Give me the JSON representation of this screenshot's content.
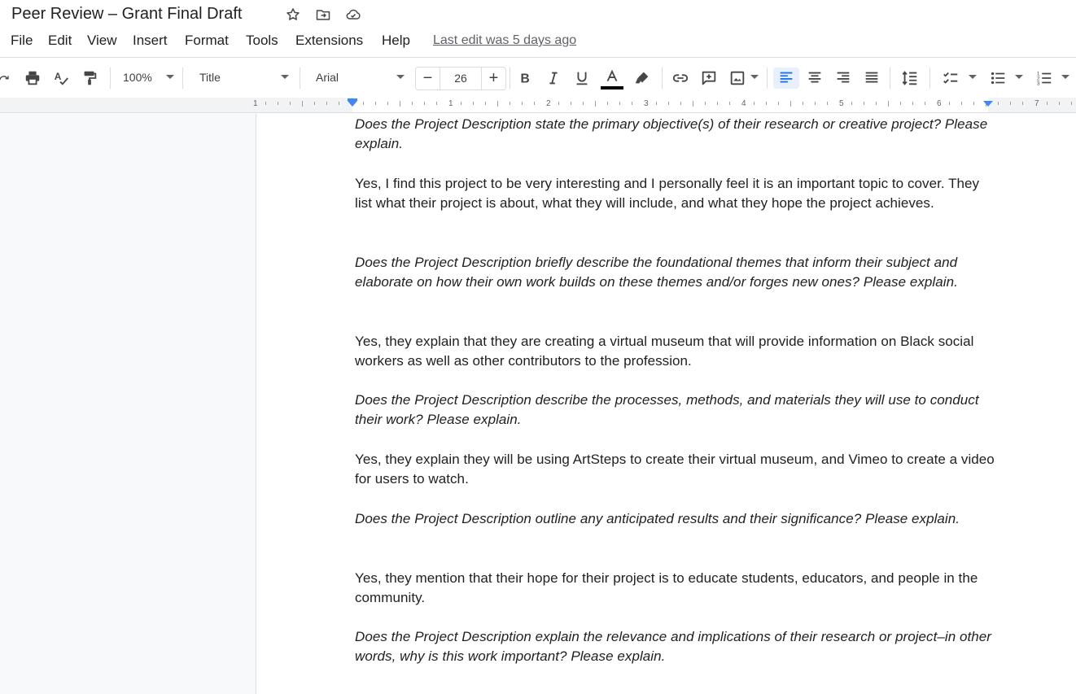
{
  "app": {
    "doc_title": "Peer Review – Grant Final Draft",
    "title_icons": [
      "star-icon",
      "move-to-folder-icon",
      "cloud-saved-icon"
    ]
  },
  "menu": {
    "items": [
      "File",
      "Edit",
      "View",
      "Insert",
      "Format",
      "Tools",
      "Extensions",
      "Help"
    ],
    "last_edit": "Last edit was 5 days ago"
  },
  "toolbar": {
    "zoom": "100%",
    "style": "Title",
    "font": "Arial",
    "font_size": "26",
    "minus_label": "−",
    "plus_label": "+",
    "text_color": "#000000",
    "icons": [
      "redo-icon",
      "print-icon",
      "spellcheck-icon",
      "paint-format-icon",
      "bold-icon",
      "italic-icon",
      "underline-icon",
      "text-color-icon",
      "highlight-icon",
      "link-icon",
      "add-comment-icon",
      "insert-image-icon",
      "align-left-icon",
      "align-center-icon",
      "align-right-icon",
      "justify-icon",
      "line-spacing-icon",
      "checklist-icon",
      "bulleted-list-icon",
      "numbered-list-icon"
    ]
  },
  "ruler": {
    "numbers": [
      "1",
      "1",
      "2",
      "3",
      "4",
      "5",
      "6",
      "7"
    ]
  },
  "document": {
    "paragraphs": [
      {
        "type": "question",
        "text": "Does the Project Description state the primary objective(s) of their research or creative project? Please explain."
      },
      {
        "type": "answer",
        "text": "Yes, I find this project to be very interesting and I personally feel it is an important topic to cover. They list what their project is about, what they will include, and what they hope the project achieves."
      },
      {
        "type": "question",
        "text": "Does the Project Description briefly describe the foundational themes that inform their subject and elaborate on how their own work builds on these themes and/or forges new ones? Please explain."
      },
      {
        "type": "answer",
        "text": "Yes, they explain that they are creating a virtual museum that will provide information on Black social workers as well as other contributors to the profession."
      },
      {
        "type": "question",
        "text": "Does the Project Description describe the processes, methods, and materials they will use to conduct their work? Please explain."
      },
      {
        "type": "answer",
        "text": "Yes, they explain they will be using ArtSteps to create their virtual museum, and Vimeo to create a video for users to watch."
      },
      {
        "type": "question",
        "text": "Does the Project Description outline any anticipated results and their significance? Please explain."
      },
      {
        "type": "answer",
        "text": "Yes, they mention that their hope for their project is to educate students, educators, and people in the community."
      },
      {
        "type": "question",
        "text": "Does the Project Description explain the relevance and implications of their research or project–in other words, why is this work important? Please explain."
      }
    ]
  },
  "colors": {
    "accent": "#4285f4",
    "active_bg": "#e8f0fe",
    "active_icon": "#1a73e8",
    "canvas_bg": "#f8f9fa"
  }
}
